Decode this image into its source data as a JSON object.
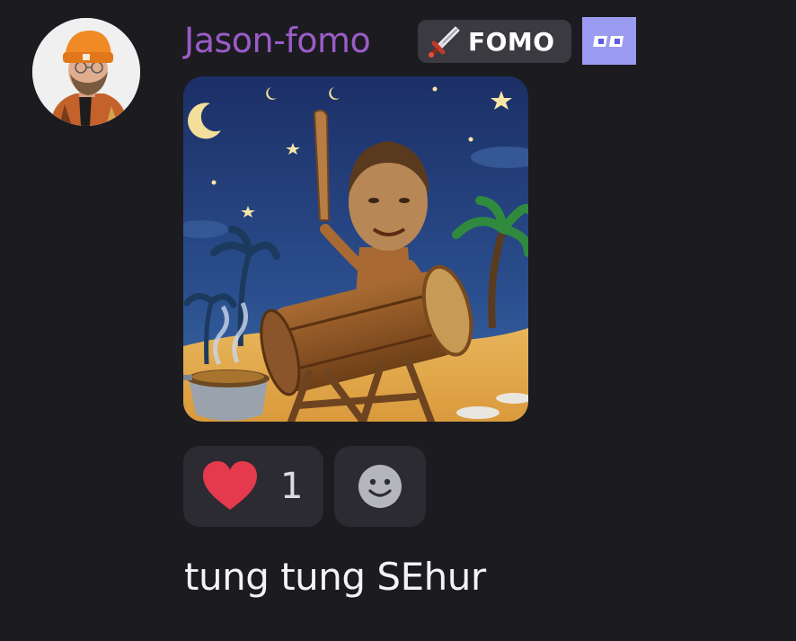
{
  "message": {
    "author": {
      "name": "Jason-fomo",
      "name_color": "#9a5cc6",
      "avatar_icon": "avatar-person-orange-beanie"
    },
    "server_tag": {
      "icon": "sword-icon",
      "label": "FOMO"
    },
    "role_badge": {
      "icon": "badge-icon",
      "color": "#9b9bf2"
    },
    "attachment": {
      "type": "image",
      "depicts": "tung-tung-sehur-drum-night-beach"
    },
    "reactions": [
      {
        "emoji": "heart-icon",
        "count": "1"
      }
    ],
    "add_reaction_icon": "smiley-icon",
    "text": "tung tung SEhur"
  },
  "colors": {
    "background": "#1b1b20",
    "reaction_bg": "#2b2b31",
    "tag_bg": "#3a3a40",
    "heart": "#e5394d"
  }
}
